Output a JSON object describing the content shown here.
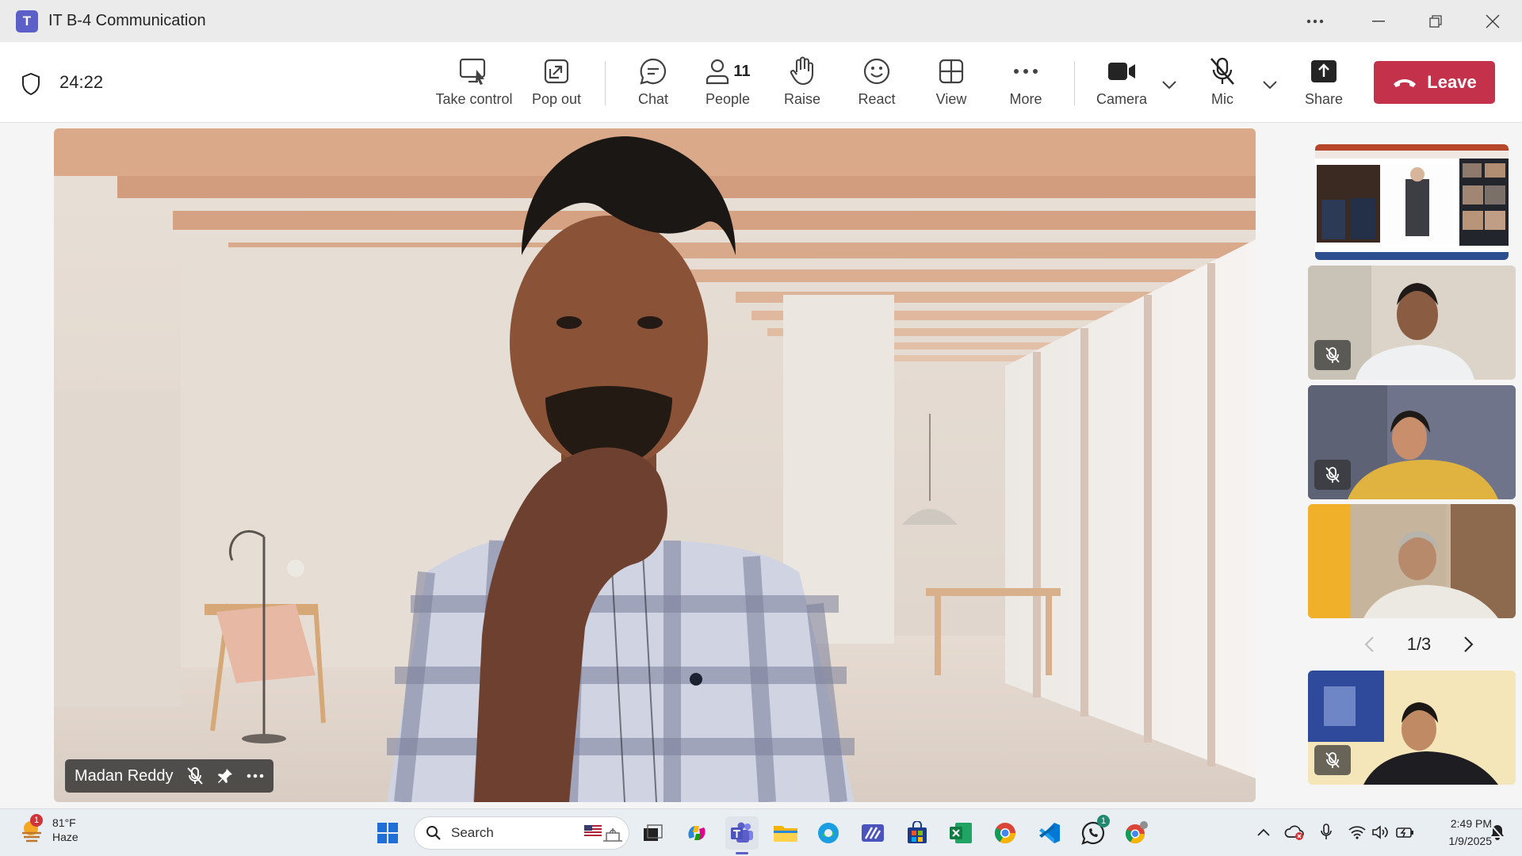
{
  "window": {
    "title": "IT B-4 Communication",
    "logo_letter": "T"
  },
  "toolbar": {
    "timer": "24:22",
    "take_control": "Take control",
    "pop_out": "Pop out",
    "chat": "Chat",
    "people": "People",
    "people_count": "11",
    "raise": "Raise",
    "react": "React",
    "view": "View",
    "more": "More",
    "camera": "Camera",
    "mic": "Mic",
    "share": "Share",
    "leave": "Leave"
  },
  "stage": {
    "speaker_name": "Madan Reddy"
  },
  "gallery": {
    "page": "1/3"
  },
  "taskbar": {
    "weather_temp": "81°F",
    "weather_desc": "Haze",
    "weather_badge": "1",
    "search_placeholder": "Search",
    "whatsapp_badge": "1",
    "time": "2:49 PM",
    "date": "1/9/2025"
  },
  "colors": {
    "teams_purple": "#5b5fc7",
    "leave_red": "#c4314b",
    "taskbar_bg": "#e9eef3"
  }
}
